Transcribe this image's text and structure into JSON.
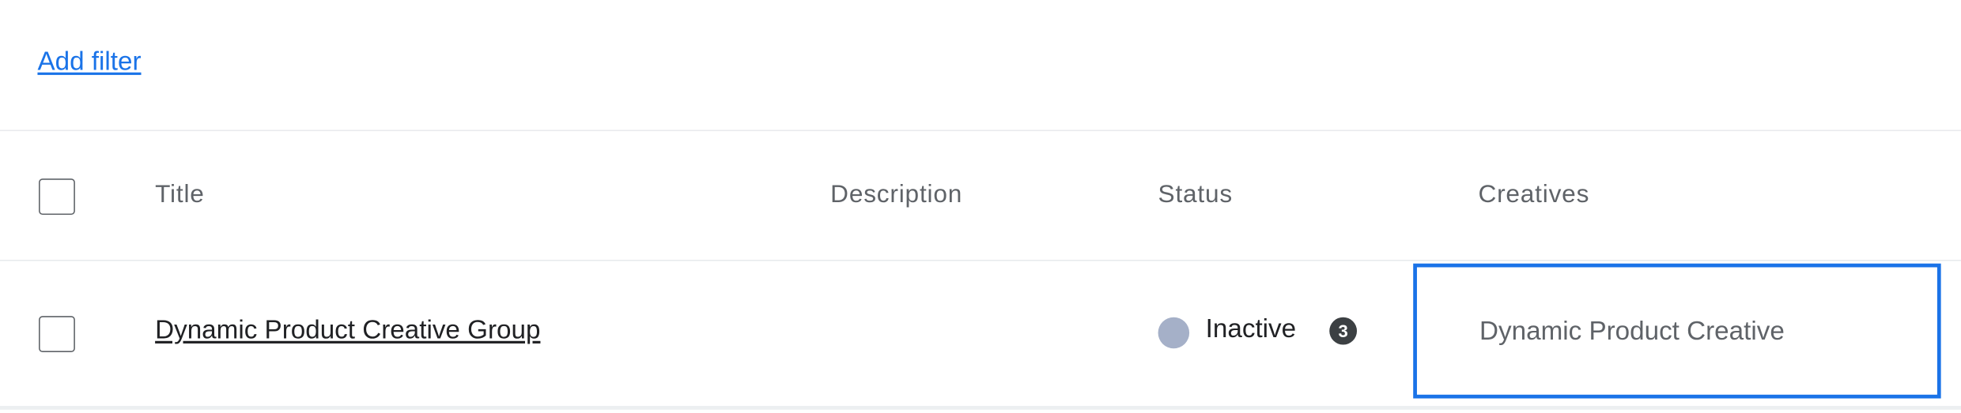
{
  "toolbar": {
    "add_filter_label": "Add filter"
  },
  "table": {
    "columns": [
      "Title",
      "Description",
      "Status",
      "Creatives"
    ],
    "rows": [
      {
        "title": "Dynamic Product Creative Group",
        "description": "",
        "status": "Inactive",
        "status_badge": "3",
        "creatives": "Dynamic Product Creative"
      }
    ]
  },
  "colors": {
    "link": "#1a73e8",
    "selection_border": "#1a73e8",
    "status_inactive_dot": "#a5b0c8"
  },
  "icons": {
    "status_dot": "status-dot-icon",
    "status_badge": "number-badge-icon"
  }
}
